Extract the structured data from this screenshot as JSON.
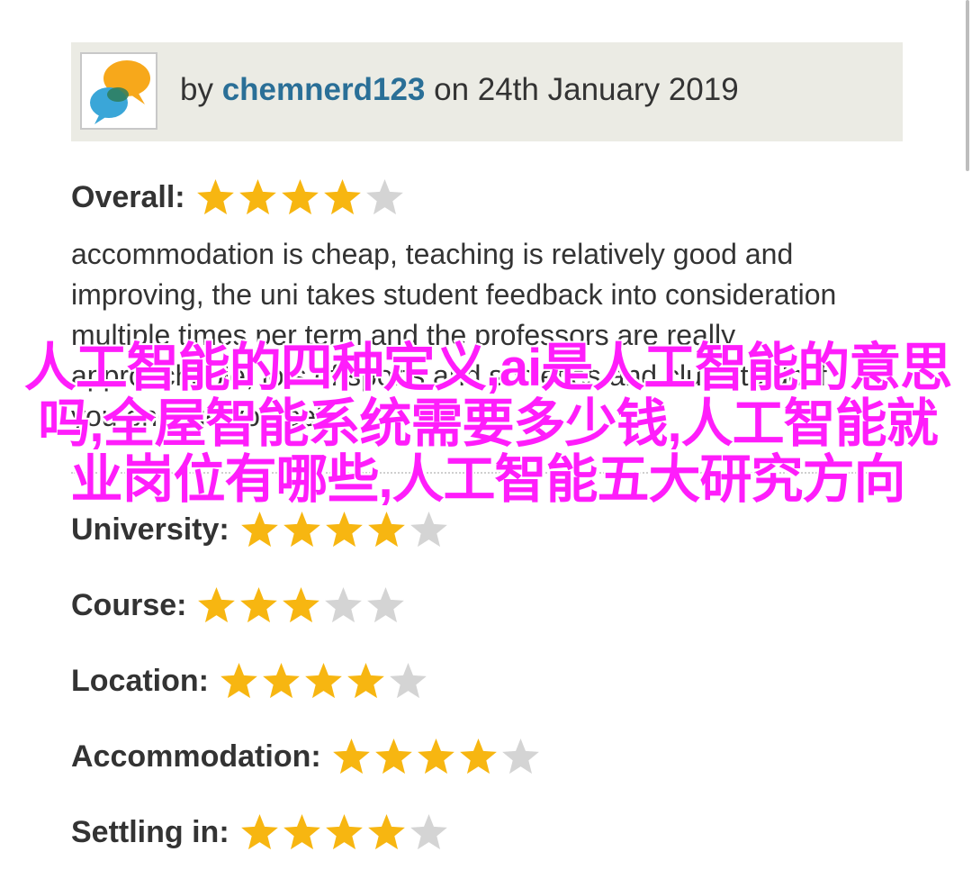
{
  "review": {
    "by_prefix": "by ",
    "author": "chemnerd123",
    "date_text": " on 24th January 2019",
    "overall_label": "Overall:",
    "overall_stars": 4,
    "body": "accommodation is cheap, teaching is relatively good and improving, the uni takes student feedback into consideration multiple times per term and the professors are really approachable, lots of sports and societies and clubs to do if you engage yourself"
  },
  "ratings": [
    {
      "label": "University:",
      "stars": 4
    },
    {
      "label": "Course:",
      "stars": 3
    },
    {
      "label": "Location:",
      "stars": 4
    },
    {
      "label": "Accommodation:",
      "stars": 4
    },
    {
      "label": "Settling in:",
      "stars": 4
    }
  ],
  "overlay_text": "人工智能的四种定义,ai是人工智能的意思吗,全屋智能系统需要多少钱,人工智能就业岗位有哪些,人工智能五大研究方向",
  "colors": {
    "header_bg": "#ebebe4",
    "author_link": "#2a6f97",
    "star_filled": "#f7b611",
    "star_empty": "#d4d4d4",
    "overlay": "#ff1dfb"
  },
  "icons": {
    "avatar": "speech-bubbles-icon",
    "star": "star-icon"
  }
}
